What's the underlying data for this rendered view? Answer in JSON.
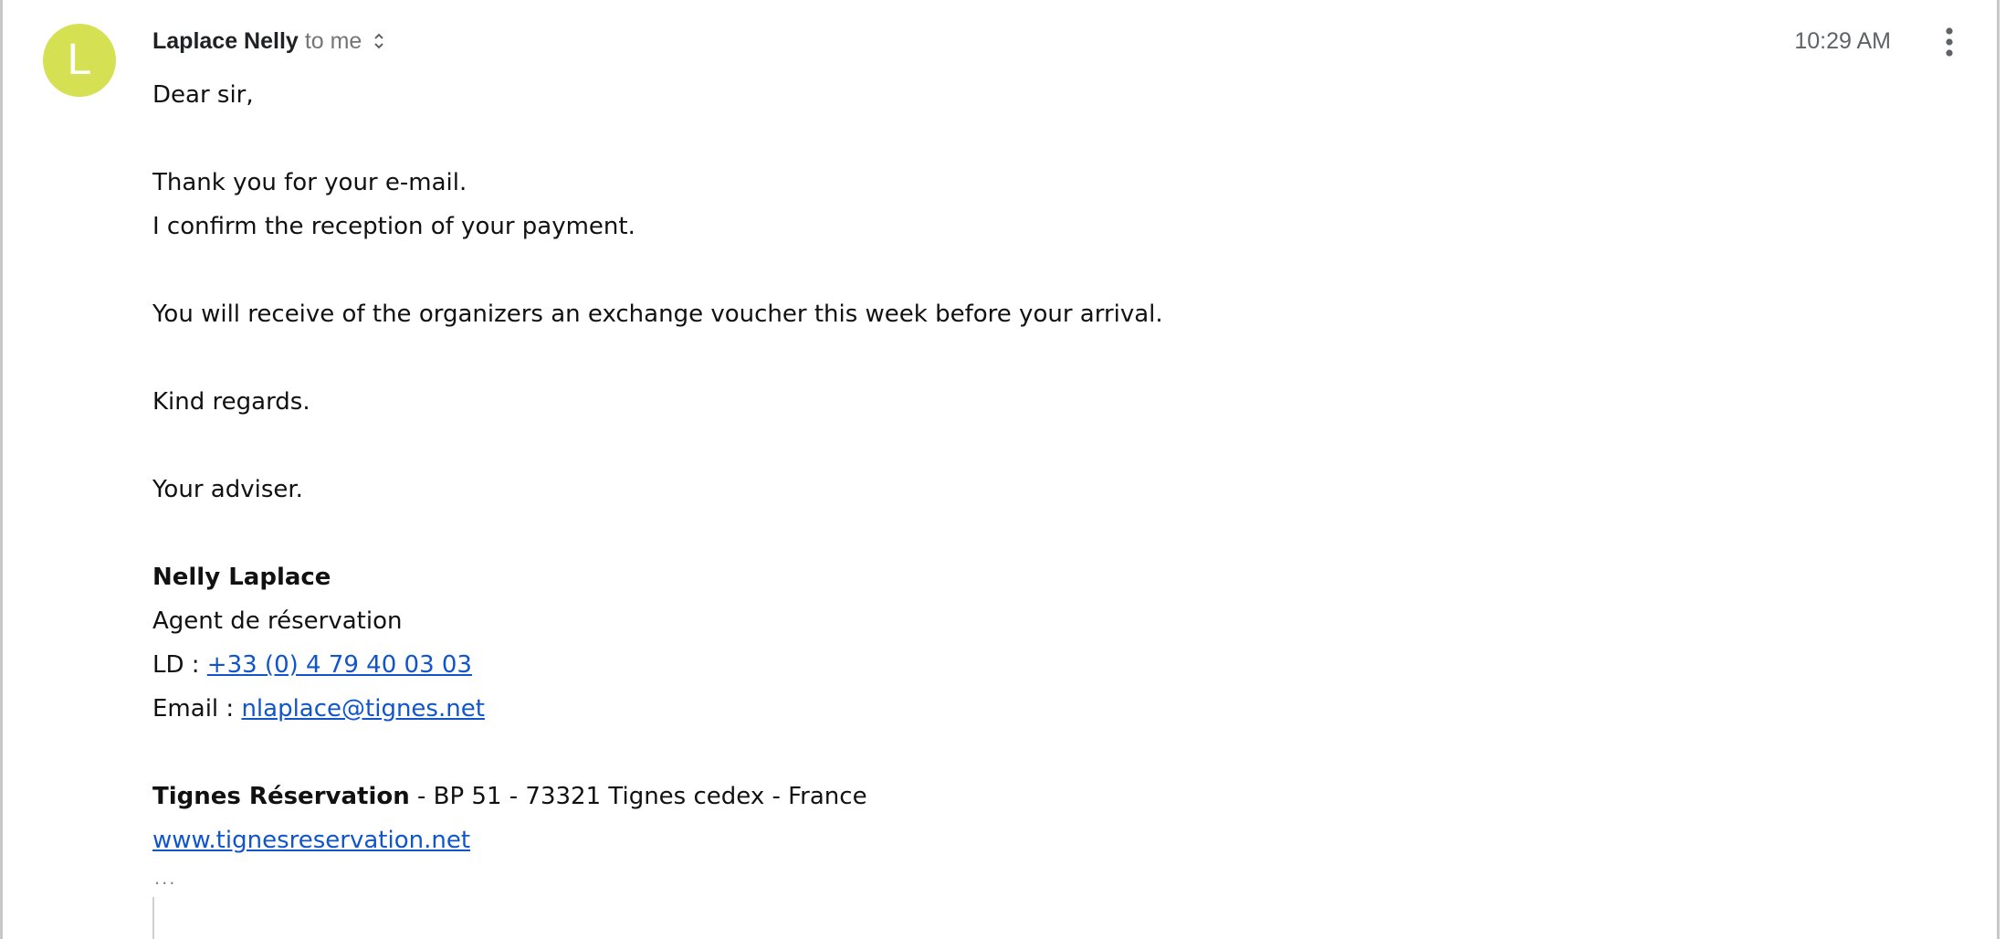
{
  "message": {
    "avatar_letter": "L",
    "avatar_color": "#d5e153",
    "sender_name": "Laplace Nelly",
    "recipient_text": "to me",
    "time": "10:29 AM",
    "icons": {
      "expand_recipients": "chevron-up-down-icon",
      "more_options": "more-vert-icon"
    }
  },
  "body": {
    "greeting": "Dear sir,",
    "line_1": "Thank you for your e-mail.",
    "line_2": "I confirm the reception of your payment.",
    "line_3": "You will receive of the organizers an exchange voucher this week before your arrival.",
    "closing": "Kind regards.",
    "sign_off": "Your adviser."
  },
  "signature": {
    "name": "Nelly Laplace",
    "role": "Agent de réservation",
    "phone_label": "LD : ",
    "phone": "+33 (0) 4 79 40 03 03",
    "email_label": "Email : ",
    "email": "nlaplace@tignes.net",
    "company": "Tignes Réservation",
    "address": " - BP 51 - 73321 Tignes cedex - France",
    "website": "www.tignesreservation.net"
  },
  "trimmed_content": {
    "ellipsis": "..."
  },
  "colors": {
    "link": "#1155cc",
    "muted": "#757575"
  }
}
